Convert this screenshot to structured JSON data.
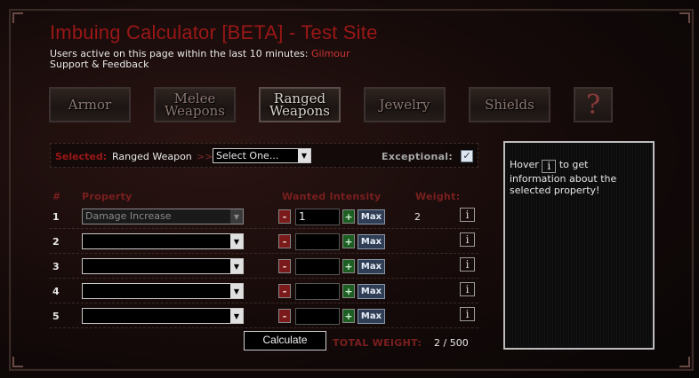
{
  "page": {
    "title": "Imbuing Calculator [BETA] - Test Site",
    "active_text": "Users active on this page within the last 10 minutes:",
    "active_user": "Gilmour",
    "support_link": "Support & Feedback"
  },
  "categories": [
    {
      "label": "Armor",
      "active": false
    },
    {
      "label": "Melee Weapons",
      "active": false
    },
    {
      "label": "Ranged Weapons",
      "active": true
    },
    {
      "label": "Jewelry",
      "active": false
    },
    {
      "label": "Shields",
      "active": false
    },
    {
      "label": "?",
      "active": false
    }
  ],
  "selection": {
    "label": "Selected:",
    "value": "Ranged Weapon",
    "arrows": ">>",
    "dropdown_value": "Select One...",
    "exceptional_label": "Exceptional:",
    "exceptional_checked": true,
    "check_glyph": "✓"
  },
  "table": {
    "headers": {
      "num": "#",
      "property": "Property",
      "intensity": "Wanted Intensity",
      "weight": "Weight:"
    },
    "minus_label": "-",
    "plus_label": "+",
    "max_label": "Max",
    "info_label": "i",
    "rows": [
      {
        "num": "1",
        "property": "Damage Increase",
        "intensity": "1",
        "weight": "2"
      },
      {
        "num": "2",
        "property": "",
        "intensity": "",
        "weight": ""
      },
      {
        "num": "3",
        "property": "",
        "intensity": "",
        "weight": ""
      },
      {
        "num": "4",
        "property": "",
        "intensity": "",
        "weight": ""
      },
      {
        "num": "5",
        "property": "",
        "intensity": "",
        "weight": ""
      }
    ]
  },
  "footer": {
    "calculate_label": "Calculate",
    "total_weight_label": "TOTAL WEIGHT:",
    "total_weight_value": "2 / 500"
  },
  "info_panel": {
    "pre": "Hover",
    "icon": "i",
    "post": "to get information about the selected property!"
  },
  "colors": {
    "accent_red": "#9a1717",
    "max_button": "#2f3e55",
    "plus_green": "#1d5e22",
    "minus_red": "#7a1a1a"
  }
}
